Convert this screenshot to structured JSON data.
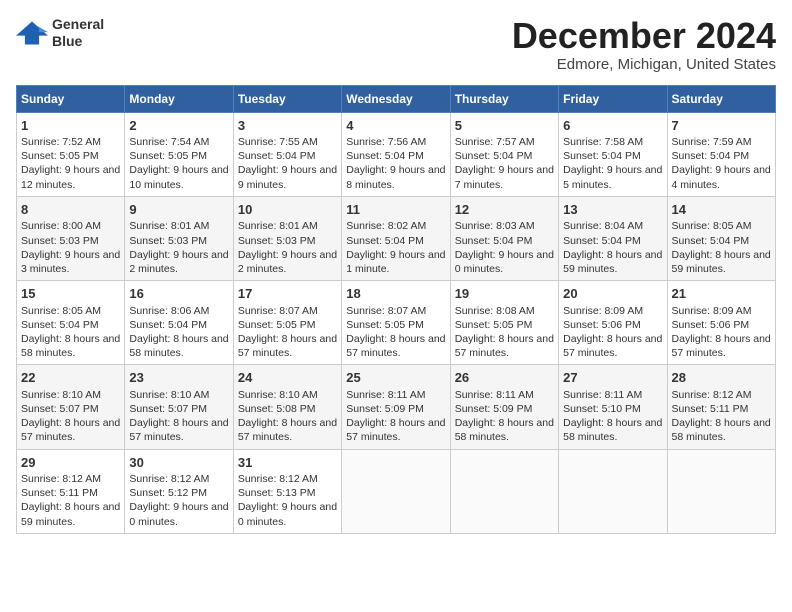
{
  "header": {
    "logo_line1": "General",
    "logo_line2": "Blue",
    "month": "December 2024",
    "location": "Edmore, Michigan, United States"
  },
  "weekdays": [
    "Sunday",
    "Monday",
    "Tuesday",
    "Wednesday",
    "Thursday",
    "Friday",
    "Saturday"
  ],
  "weeks": [
    [
      {
        "day": "1",
        "sunrise": "Sunrise: 7:52 AM",
        "sunset": "Sunset: 5:05 PM",
        "daylight": "Daylight: 9 hours and 12 minutes."
      },
      {
        "day": "2",
        "sunrise": "Sunrise: 7:54 AM",
        "sunset": "Sunset: 5:05 PM",
        "daylight": "Daylight: 9 hours and 10 minutes."
      },
      {
        "day": "3",
        "sunrise": "Sunrise: 7:55 AM",
        "sunset": "Sunset: 5:04 PM",
        "daylight": "Daylight: 9 hours and 9 minutes."
      },
      {
        "day": "4",
        "sunrise": "Sunrise: 7:56 AM",
        "sunset": "Sunset: 5:04 PM",
        "daylight": "Daylight: 9 hours and 8 minutes."
      },
      {
        "day": "5",
        "sunrise": "Sunrise: 7:57 AM",
        "sunset": "Sunset: 5:04 PM",
        "daylight": "Daylight: 9 hours and 7 minutes."
      },
      {
        "day": "6",
        "sunrise": "Sunrise: 7:58 AM",
        "sunset": "Sunset: 5:04 PM",
        "daylight": "Daylight: 9 hours and 5 minutes."
      },
      {
        "day": "7",
        "sunrise": "Sunrise: 7:59 AM",
        "sunset": "Sunset: 5:04 PM",
        "daylight": "Daylight: 9 hours and 4 minutes."
      }
    ],
    [
      {
        "day": "8",
        "sunrise": "Sunrise: 8:00 AM",
        "sunset": "Sunset: 5:03 PM",
        "daylight": "Daylight: 9 hours and 3 minutes."
      },
      {
        "day": "9",
        "sunrise": "Sunrise: 8:01 AM",
        "sunset": "Sunset: 5:03 PM",
        "daylight": "Daylight: 9 hours and 2 minutes."
      },
      {
        "day": "10",
        "sunrise": "Sunrise: 8:01 AM",
        "sunset": "Sunset: 5:03 PM",
        "daylight": "Daylight: 9 hours and 2 minutes."
      },
      {
        "day": "11",
        "sunrise": "Sunrise: 8:02 AM",
        "sunset": "Sunset: 5:04 PM",
        "daylight": "Daylight: 9 hours and 1 minute."
      },
      {
        "day": "12",
        "sunrise": "Sunrise: 8:03 AM",
        "sunset": "Sunset: 5:04 PM",
        "daylight": "Daylight: 9 hours and 0 minutes."
      },
      {
        "day": "13",
        "sunrise": "Sunrise: 8:04 AM",
        "sunset": "Sunset: 5:04 PM",
        "daylight": "Daylight: 8 hours and 59 minutes."
      },
      {
        "day": "14",
        "sunrise": "Sunrise: 8:05 AM",
        "sunset": "Sunset: 5:04 PM",
        "daylight": "Daylight: 8 hours and 59 minutes."
      }
    ],
    [
      {
        "day": "15",
        "sunrise": "Sunrise: 8:05 AM",
        "sunset": "Sunset: 5:04 PM",
        "daylight": "Daylight: 8 hours and 58 minutes."
      },
      {
        "day": "16",
        "sunrise": "Sunrise: 8:06 AM",
        "sunset": "Sunset: 5:04 PM",
        "daylight": "Daylight: 8 hours and 58 minutes."
      },
      {
        "day": "17",
        "sunrise": "Sunrise: 8:07 AM",
        "sunset": "Sunset: 5:05 PM",
        "daylight": "Daylight: 8 hours and 57 minutes."
      },
      {
        "day": "18",
        "sunrise": "Sunrise: 8:07 AM",
        "sunset": "Sunset: 5:05 PM",
        "daylight": "Daylight: 8 hours and 57 minutes."
      },
      {
        "day": "19",
        "sunrise": "Sunrise: 8:08 AM",
        "sunset": "Sunset: 5:05 PM",
        "daylight": "Daylight: 8 hours and 57 minutes."
      },
      {
        "day": "20",
        "sunrise": "Sunrise: 8:09 AM",
        "sunset": "Sunset: 5:06 PM",
        "daylight": "Daylight: 8 hours and 57 minutes."
      },
      {
        "day": "21",
        "sunrise": "Sunrise: 8:09 AM",
        "sunset": "Sunset: 5:06 PM",
        "daylight": "Daylight: 8 hours and 57 minutes."
      }
    ],
    [
      {
        "day": "22",
        "sunrise": "Sunrise: 8:10 AM",
        "sunset": "Sunset: 5:07 PM",
        "daylight": "Daylight: 8 hours and 57 minutes."
      },
      {
        "day": "23",
        "sunrise": "Sunrise: 8:10 AM",
        "sunset": "Sunset: 5:07 PM",
        "daylight": "Daylight: 8 hours and 57 minutes."
      },
      {
        "day": "24",
        "sunrise": "Sunrise: 8:10 AM",
        "sunset": "Sunset: 5:08 PM",
        "daylight": "Daylight: 8 hours and 57 minutes."
      },
      {
        "day": "25",
        "sunrise": "Sunrise: 8:11 AM",
        "sunset": "Sunset: 5:09 PM",
        "daylight": "Daylight: 8 hours and 57 minutes."
      },
      {
        "day": "26",
        "sunrise": "Sunrise: 8:11 AM",
        "sunset": "Sunset: 5:09 PM",
        "daylight": "Daylight: 8 hours and 58 minutes."
      },
      {
        "day": "27",
        "sunrise": "Sunrise: 8:11 AM",
        "sunset": "Sunset: 5:10 PM",
        "daylight": "Daylight: 8 hours and 58 minutes."
      },
      {
        "day": "28",
        "sunrise": "Sunrise: 8:12 AM",
        "sunset": "Sunset: 5:11 PM",
        "daylight": "Daylight: 8 hours and 58 minutes."
      }
    ],
    [
      {
        "day": "29",
        "sunrise": "Sunrise: 8:12 AM",
        "sunset": "Sunset: 5:11 PM",
        "daylight": "Daylight: 8 hours and 59 minutes."
      },
      {
        "day": "30",
        "sunrise": "Sunrise: 8:12 AM",
        "sunset": "Sunset: 5:12 PM",
        "daylight": "Daylight: 9 hours and 0 minutes."
      },
      {
        "day": "31",
        "sunrise": "Sunrise: 8:12 AM",
        "sunset": "Sunset: 5:13 PM",
        "daylight": "Daylight: 9 hours and 0 minutes."
      },
      null,
      null,
      null,
      null
    ]
  ]
}
